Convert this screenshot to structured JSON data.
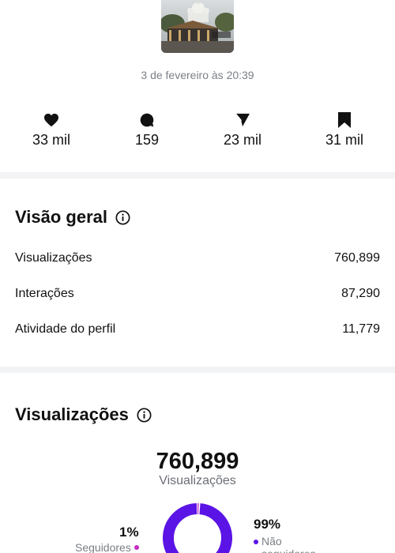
{
  "post": {
    "date": "3 de fevereiro às 20:39",
    "stats": [
      {
        "icon": "heart-icon",
        "value": "33 mil"
      },
      {
        "icon": "comment-icon",
        "value": "159"
      },
      {
        "icon": "send-icon",
        "value": "23 mil"
      },
      {
        "icon": "bookmark-icon",
        "value": "31 mil"
      }
    ]
  },
  "overview": {
    "title": "Visão geral",
    "rows": [
      {
        "label": "Visualizações",
        "value": "760,899"
      },
      {
        "label": "Interações",
        "value": "87,290"
      },
      {
        "label": "Atividade do perfil",
        "value": "11,779"
      }
    ]
  },
  "views": {
    "title": "Visualizações",
    "total": "760,899",
    "total_label": "Visualizações",
    "followers_pct": "1%",
    "followers_label": "Seguidores",
    "followers_fraction": 0.01,
    "nonfollowers_pct": "99%",
    "nonfollowers_label": "Não seguidores",
    "colors": {
      "followers": "#c62cc5",
      "nonfollowers": "#5b14e6",
      "ring_bg": "#eeeeee"
    }
  }
}
